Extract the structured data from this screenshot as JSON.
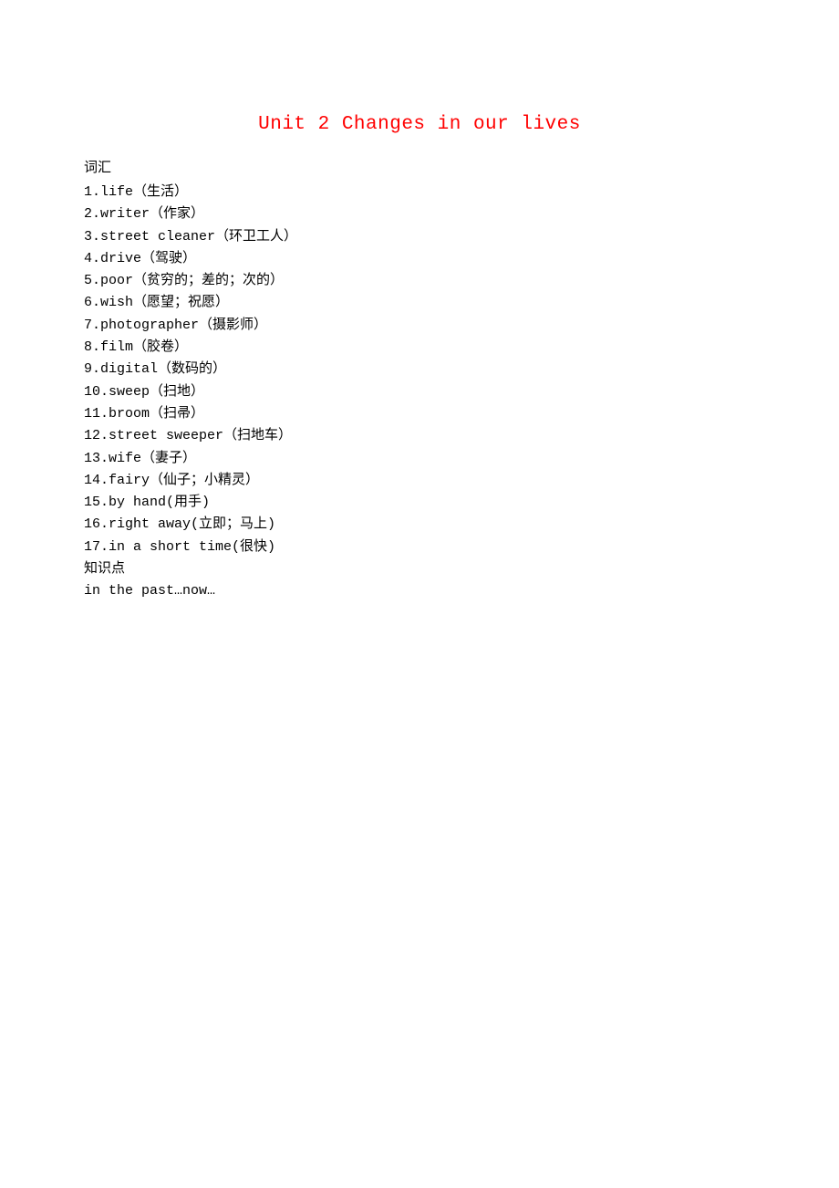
{
  "title": "Unit 2   Changes in our lives",
  "sectionHeading": "词汇",
  "items": [
    "1.life（生活）",
    "2.writer（作家）",
    "3.street cleaner（环卫工人）",
    "4.drive（驾驶）",
    "5.poor（贫穷的；差的；次的）",
    "6.wish（愿望；祝愿）",
    "7.photographer（摄影师）",
    "8.film（胶卷）",
    "9.digital（数码的）",
    "10.sweep（扫地）",
    "11.broom（扫帚）",
    "12.street sweeper（扫地车）",
    "13.wife（妻子）",
    "14.fairy（仙子；小精灵）",
    "15.by hand(用手)",
    "16.right away(立即；马上)",
    "17.in a short time(很快)",
    "知识点",
    "in the past…now…"
  ]
}
